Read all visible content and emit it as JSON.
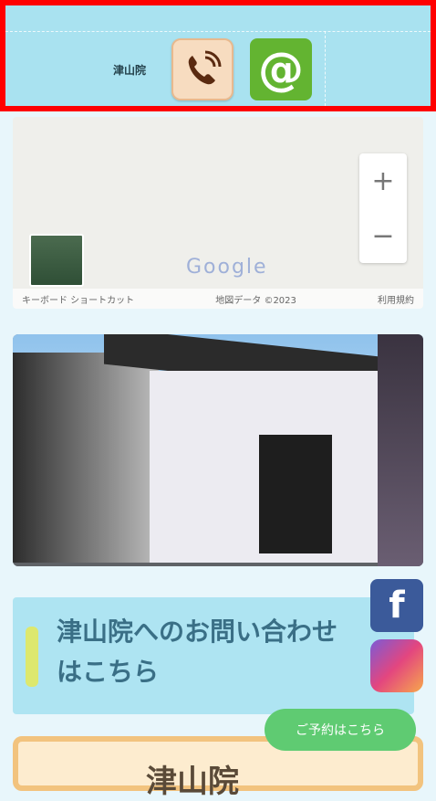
{
  "header": {
    "brand": "津山院",
    "phone_icon": "phone-icon",
    "mail_icon": "at-sign-icon",
    "mail_glyph": "@"
  },
  "map": {
    "zoom_in": "+",
    "zoom_out": "−",
    "logo": "Google",
    "footer_left": "キーボード ショートカット",
    "footer_mid": "地図データ ©2023",
    "footer_right": "利用規約"
  },
  "info": {
    "text": "津山院へのお問い合わせはこちら"
  },
  "social": {
    "facebook_glyph": "f"
  },
  "cta": {
    "label": "ご予約はこちら"
  },
  "card": {
    "title": "津山院"
  },
  "colors": {
    "header_bg": "#a9e2f0",
    "highlight_border": "#ff0000",
    "mail_green": "#63b431",
    "facebook": "#3b5a9a"
  }
}
